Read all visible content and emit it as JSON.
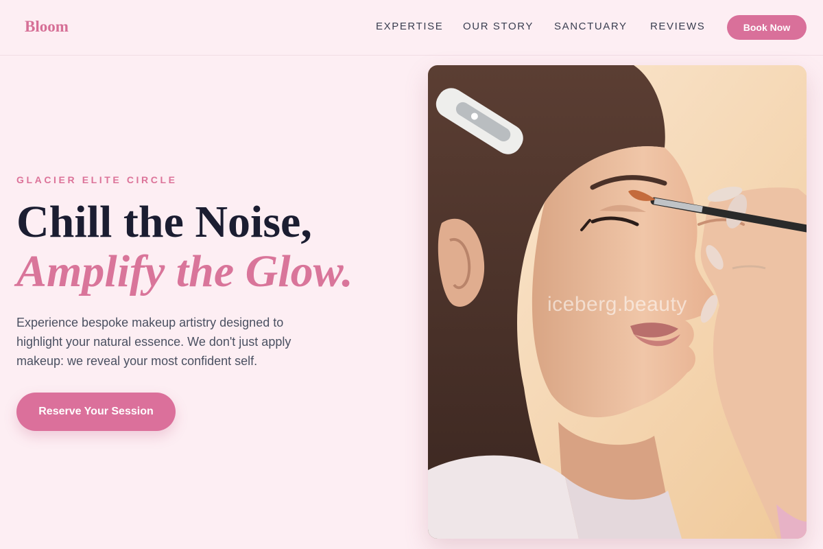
{
  "header": {
    "brand": "Bloom",
    "nav": [
      {
        "label": "EXPERTISE"
      },
      {
        "label": "OUR STORY"
      },
      {
        "label": "SANCTUARY"
      },
      {
        "label": "REVIEWS"
      }
    ],
    "book_button": "Book Now"
  },
  "hero": {
    "eyebrow": "GLACIER ELITE CIRCLE",
    "headline_line1": "Chill the Noise,",
    "headline_line2": "Amplify the Glow.",
    "description": "Experience bespoke makeup artistry designed to highlight your natural essence. We don't just apply makeup: we reveal your most confident self.",
    "cta": "Reserve Your Session",
    "image_watermark": "iceberg.beauty"
  },
  "colors": {
    "background": "#fdeef3",
    "accent": "#d9709a",
    "heading": "#1b1d31",
    "body_text": "#4a5061"
  }
}
